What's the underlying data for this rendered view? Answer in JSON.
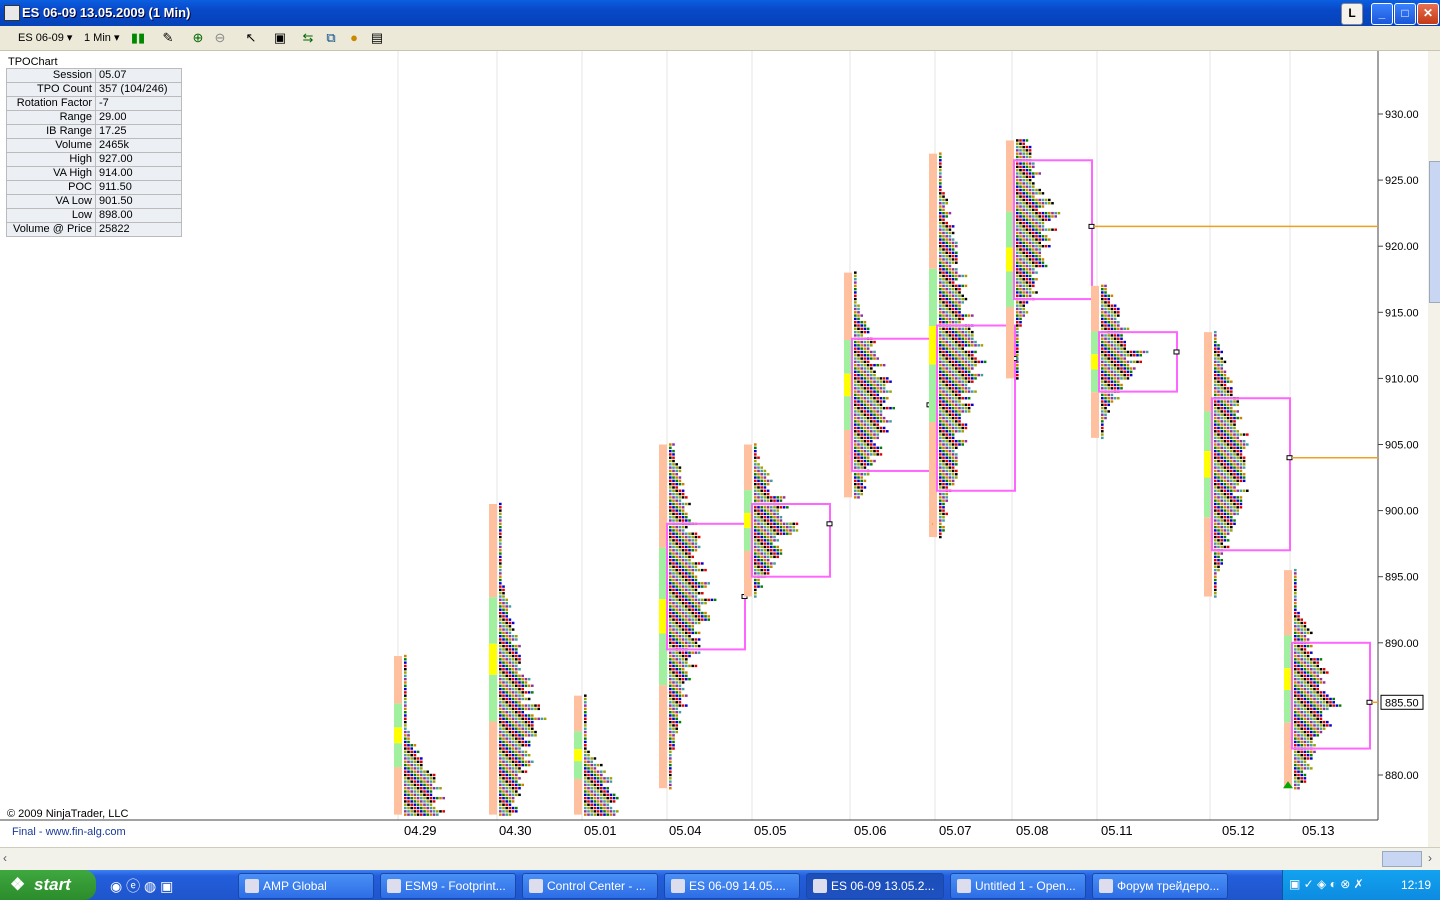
{
  "window": {
    "title": "ES 06-09  13.05.2009 (1 Min)",
    "btn_l": "L",
    "btn_min": "_",
    "btn_max": "□",
    "btn_close": "✕"
  },
  "toolbar": {
    "instrument": "ES 06-09",
    "interval": "1 Min"
  },
  "chart_data": {
    "type": "table",
    "title": "TPOChart",
    "stats": [
      {
        "label": "Session",
        "value": "05.07"
      },
      {
        "label": "TPO Count",
        "value": "357 (104/246)"
      },
      {
        "label": "Rotation Factor",
        "value": "-7"
      },
      {
        "label": "Range",
        "value": "29.00"
      },
      {
        "label": "IB Range",
        "value": "17.25"
      },
      {
        "label": "Volume",
        "value": "2465k"
      },
      {
        "label": "High",
        "value": "927.00"
      },
      {
        "label": "VA High",
        "value": "914.00"
      },
      {
        "label": "POC",
        "value": "911.50"
      },
      {
        "label": "VA Low",
        "value": "901.50"
      },
      {
        "label": "Low",
        "value": "898.00"
      },
      {
        "label": "Volume @ Price",
        "value": "25822"
      }
    ],
    "y_ticks": [
      "930.00",
      "925.00",
      "920.00",
      "915.00",
      "910.00",
      "905.00",
      "900.00",
      "895.00",
      "890.00",
      "880.00"
    ],
    "ylim": [
      876.5,
      934.5
    ],
    "current_price": "885.50",
    "sessions": [
      {
        "date": "04.29",
        "low": 877,
        "high": 889,
        "poc": 878
      },
      {
        "date": "04.30",
        "low": 877,
        "high": 900.5,
        "poc": 884
      },
      {
        "date": "05.01",
        "low": 877,
        "high": 886,
        "poc": 878
      },
      {
        "date": "05.04",
        "low": 879,
        "high": 905,
        "poc": 893.5,
        "va_low": 889.5,
        "va_high": 899
      },
      {
        "date": "05.05",
        "low": 893.5,
        "high": 905,
        "poc": 899,
        "va_low": 895,
        "va_high": 900.5
      },
      {
        "date": "05.06",
        "low": 901,
        "high": 918,
        "poc": 908,
        "va_low": 903,
        "va_high": 913
      },
      {
        "date": "05.07",
        "low": 898,
        "high": 927,
        "poc": 911.5,
        "va_low": 901.5,
        "va_high": 914
      },
      {
        "date": "05.08",
        "low": 910,
        "high": 928,
        "poc": 921.5,
        "va_low": 916,
        "va_high": 926.5
      },
      {
        "date": "05.11",
        "low": 905.5,
        "high": 917,
        "poc": 912,
        "va_low": 909,
        "va_high": 913.5
      },
      {
        "date": "05.12",
        "low": 893.5,
        "high": 913.5,
        "poc": 904,
        "va_low": 897,
        "va_high": 908.5
      },
      {
        "date": "05.13",
        "low": 879,
        "high": 895.5,
        "poc": 885.5,
        "va_low": 882,
        "va_high": 890
      }
    ],
    "colors": {
      "tpo_palette": [
        "#000000",
        "#e00000",
        "#0000d0",
        "#008000",
        "#d08000",
        "#9030a0",
        "#40a0a0",
        "#a0a000"
      ],
      "va_box": "#ff66ff",
      "poc_line": "#f0a020",
      "session_bar": [
        "#ffc0a0",
        "#a0f0a0",
        "#ffff00",
        "#e00000",
        "#0000d0"
      ]
    }
  },
  "footer": {
    "copyright": "© 2009 NinjaTrader, LLC",
    "brand": "Final - www.fin-alg.com"
  },
  "taskbar": {
    "start": "start",
    "tasks": [
      "AMP Global",
      "ESM9 - Footprint...",
      "Control Center - ...",
      "ES 06-09  14.05....",
      "ES 06-09  13.05.2...",
      "Untitled 1 - Open...",
      "Форум трейдеро..."
    ],
    "clock": "12:19"
  }
}
